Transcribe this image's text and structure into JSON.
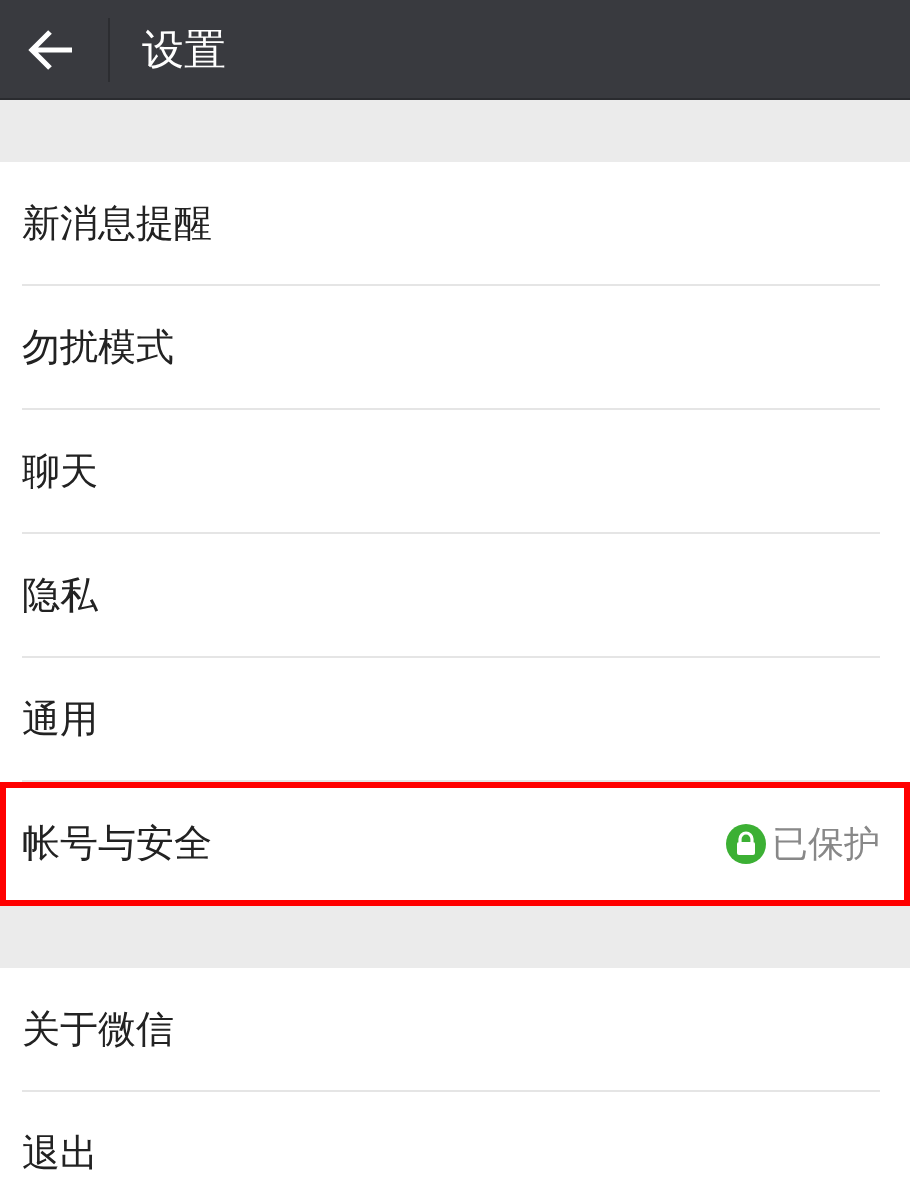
{
  "header": {
    "title": "设置"
  },
  "sections": [
    {
      "items": [
        {
          "label": "新消息提醒",
          "highlighted": false
        },
        {
          "label": "勿扰模式",
          "highlighted": false
        },
        {
          "label": "聊天",
          "highlighted": false
        },
        {
          "label": "隐私",
          "highlighted": false
        },
        {
          "label": "通用",
          "highlighted": false
        },
        {
          "label": "帐号与安全",
          "highlighted": true,
          "status": {
            "kind": "protected",
            "text": "已保护"
          }
        }
      ]
    },
    {
      "items": [
        {
          "label": "关于微信",
          "highlighted": false
        },
        {
          "label": "退出",
          "highlighted": false
        }
      ]
    }
  ]
}
